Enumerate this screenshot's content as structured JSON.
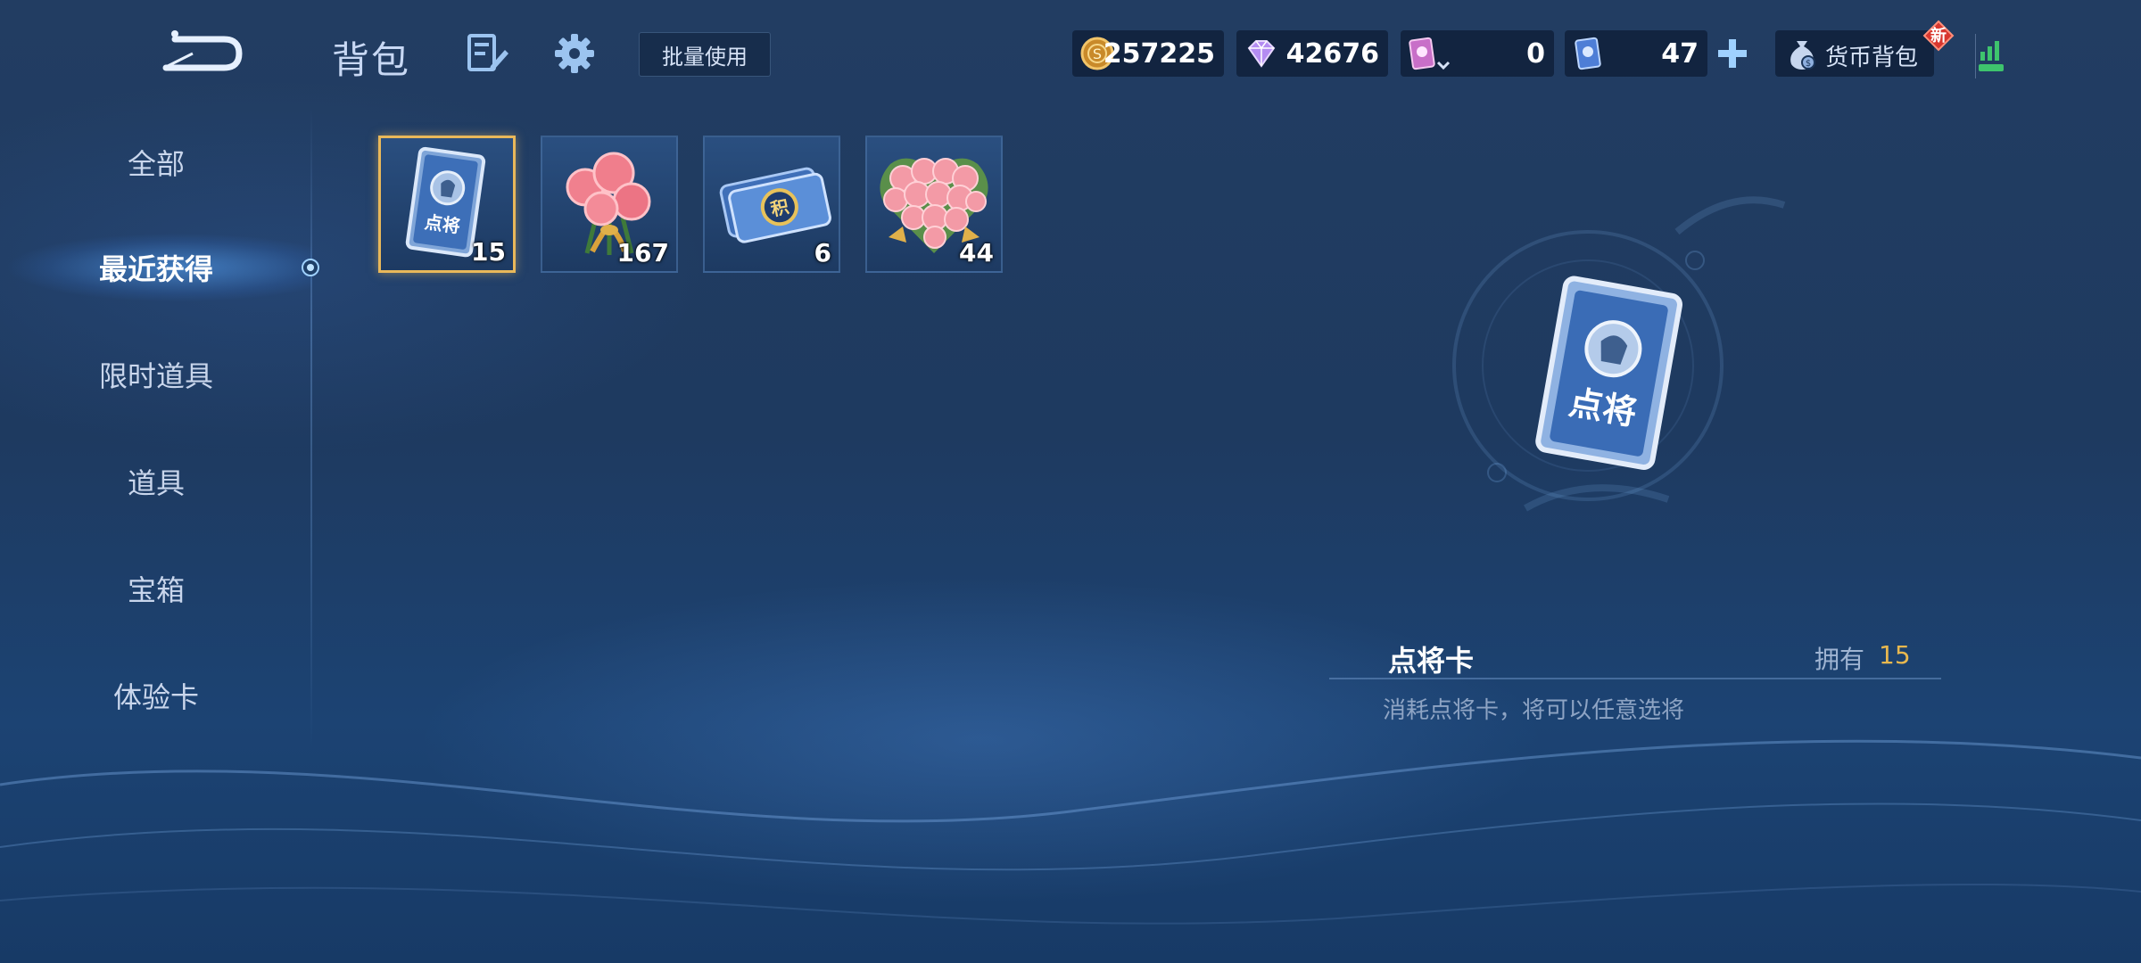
{
  "header": {
    "title": "背包",
    "batch_use_label": "批量使用",
    "new_badge": "新",
    "wallet_label": "货币背包",
    "currencies": [
      {
        "name": "gold-coin",
        "value": "257225"
      },
      {
        "name": "diamond",
        "value": "42676"
      },
      {
        "name": "purple-card",
        "value": "0"
      },
      {
        "name": "blue-card",
        "value": "47"
      }
    ]
  },
  "sidebar": {
    "items": [
      {
        "label": "全部"
      },
      {
        "label": "最近获得"
      },
      {
        "label": "限时道具"
      },
      {
        "label": "道具"
      },
      {
        "label": "宝箱"
      },
      {
        "label": "体验卡"
      }
    ],
    "active_index": 1
  },
  "items": [
    {
      "icon": "hero-select-card-icon",
      "count": "15",
      "card_text": "点将"
    },
    {
      "icon": "rose-bouquet-icon",
      "count": "167"
    },
    {
      "icon": "points-ticket-icon",
      "count": "6",
      "ticket_text": "积"
    },
    {
      "icon": "rose-heart-icon",
      "count": "44"
    }
  ],
  "detail": {
    "name": "点将卡",
    "owned_label": "拥有",
    "owned_count": "15",
    "description": "消耗点将卡，将可以任意选将",
    "card_text": "点将"
  },
  "colors": {
    "accent_gold": "#e8b84f",
    "selected_border": "#e9b85a",
    "background": "#1e3a60"
  }
}
